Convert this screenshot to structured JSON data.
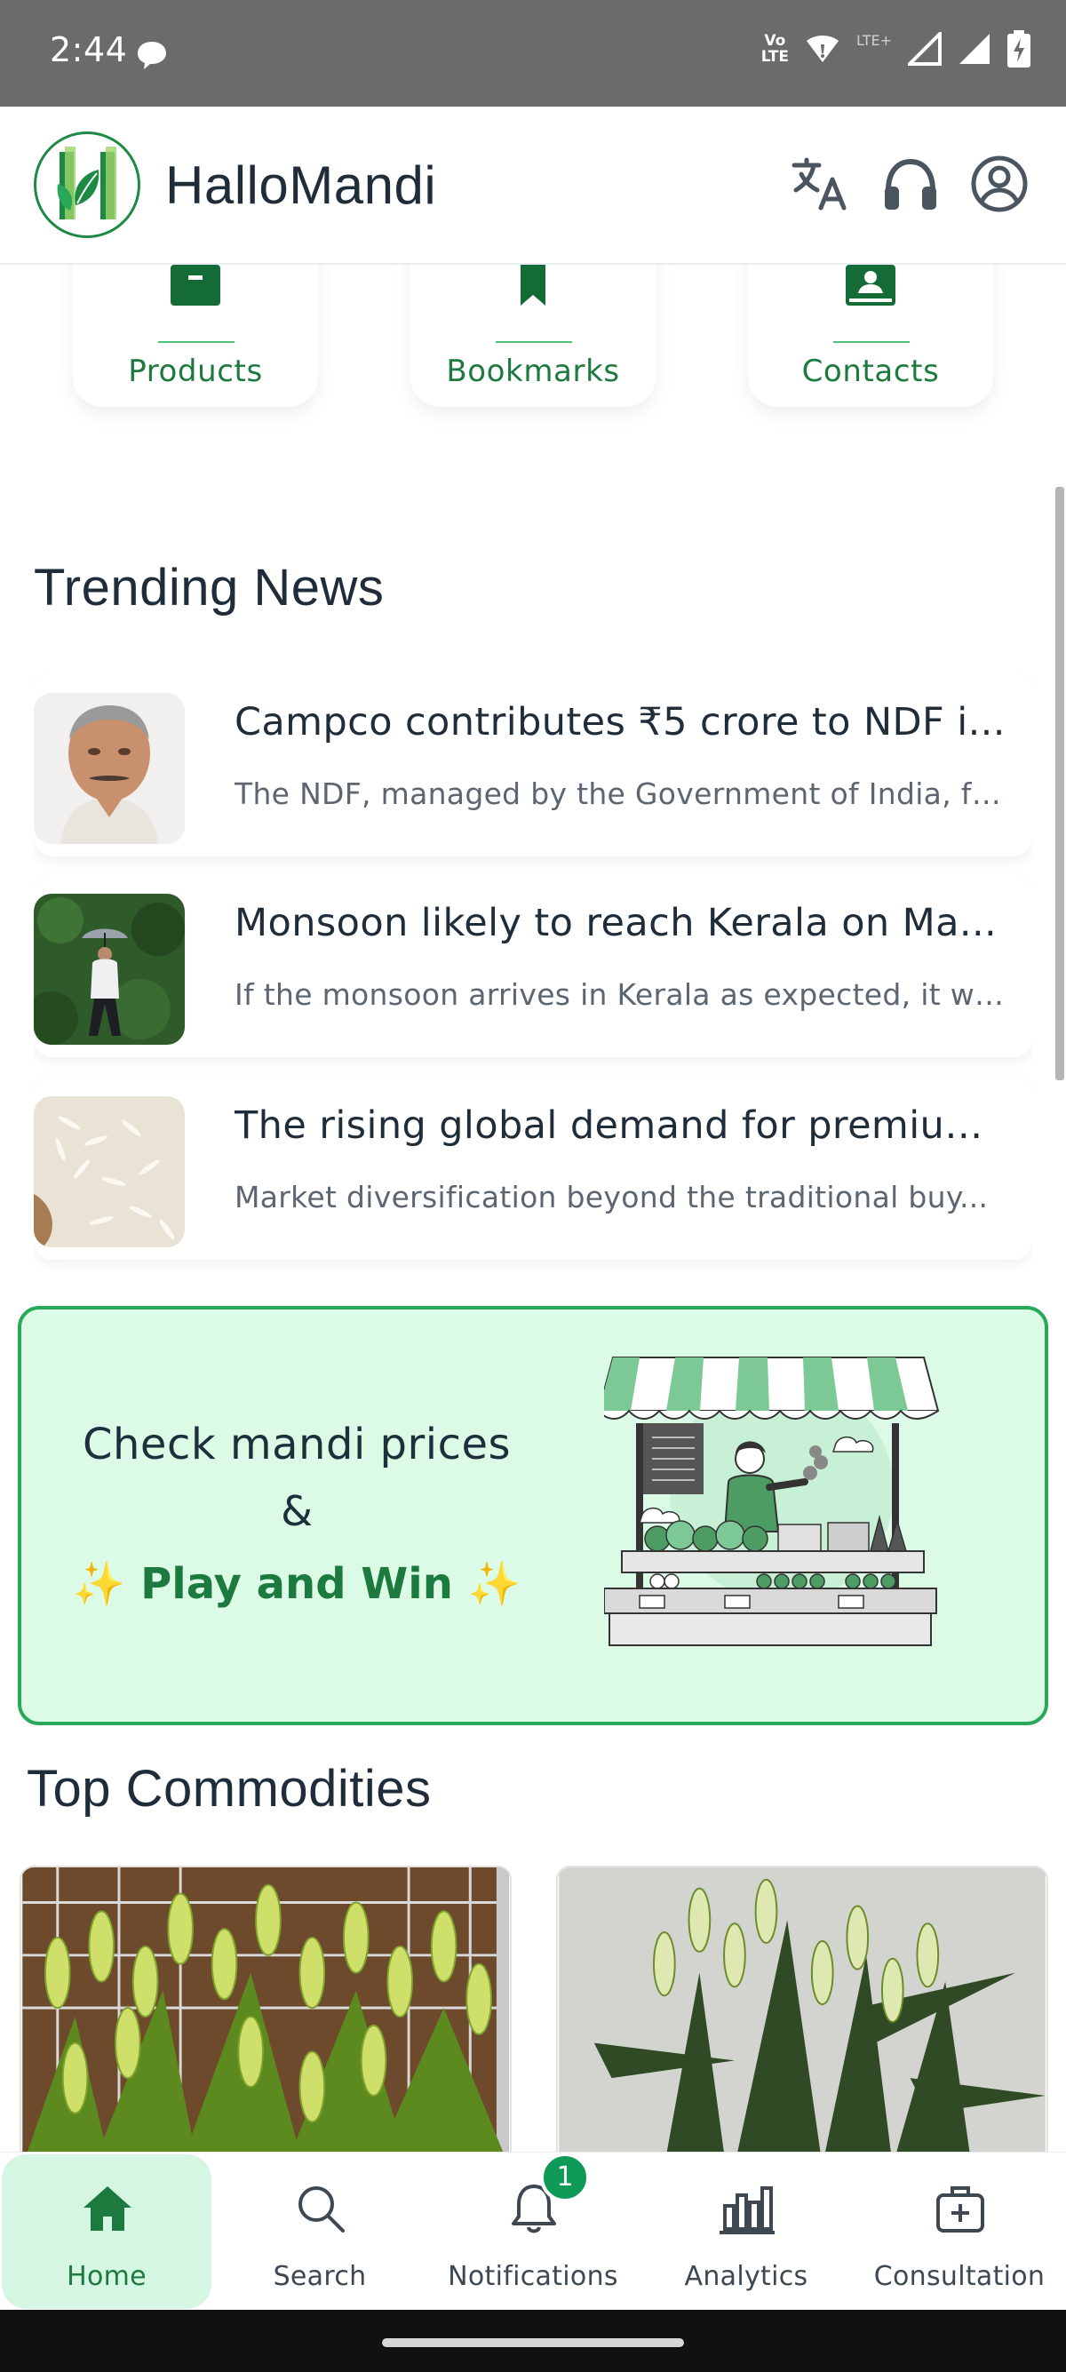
{
  "status_bar": {
    "time": "2:44",
    "volte_line1": "Vo",
    "volte_line2": "LTE",
    "lte_plus": "LTE+"
  },
  "header": {
    "brand": "HalloMandi",
    "icons": [
      "translate-icon",
      "headset-icon",
      "account-icon"
    ]
  },
  "quick_actions": [
    {
      "label": "Products",
      "icon": "products-icon"
    },
    {
      "label": "Bookmarks",
      "icon": "bookmark-icon"
    },
    {
      "label": "Contacts",
      "icon": "contacts-icon"
    }
  ],
  "trending": {
    "title": "Trending News",
    "items": [
      {
        "title": "Campco contributes ₹5 crore to NDF i...",
        "desc": "The NDF, managed by the Government of India, fo..."
      },
      {
        "title": "Monsoon likely to reach Kerala on Ma...",
        "desc": "If the monsoon arrives in Kerala as expected, it wi..."
      },
      {
        "title": "The rising global demand for premium...",
        "desc": "Market diversification beyond the traditional buy..."
      }
    ]
  },
  "promo": {
    "line1": "Check mandi prices",
    "amp": "&",
    "line2": "✨ Play and Win ✨"
  },
  "commodities": {
    "title": "Top Commodities"
  },
  "bottom_nav": {
    "items": [
      {
        "label": "Home",
        "icon": "home-icon",
        "active": true
      },
      {
        "label": "Search",
        "icon": "search-icon"
      },
      {
        "label": "Notifications",
        "icon": "bell-icon",
        "badge": "1"
      },
      {
        "label": "Analytics",
        "icon": "analytics-icon"
      },
      {
        "label": "Consultation",
        "icon": "consultation-icon"
      }
    ]
  },
  "colors": {
    "brand_green": "#1c7a3e",
    "accent_green": "#2aa85a",
    "promo_bg": "#dcfbe7",
    "active_nav_bg": "#d6f6e4",
    "status_bar": "#6b6b6b"
  }
}
